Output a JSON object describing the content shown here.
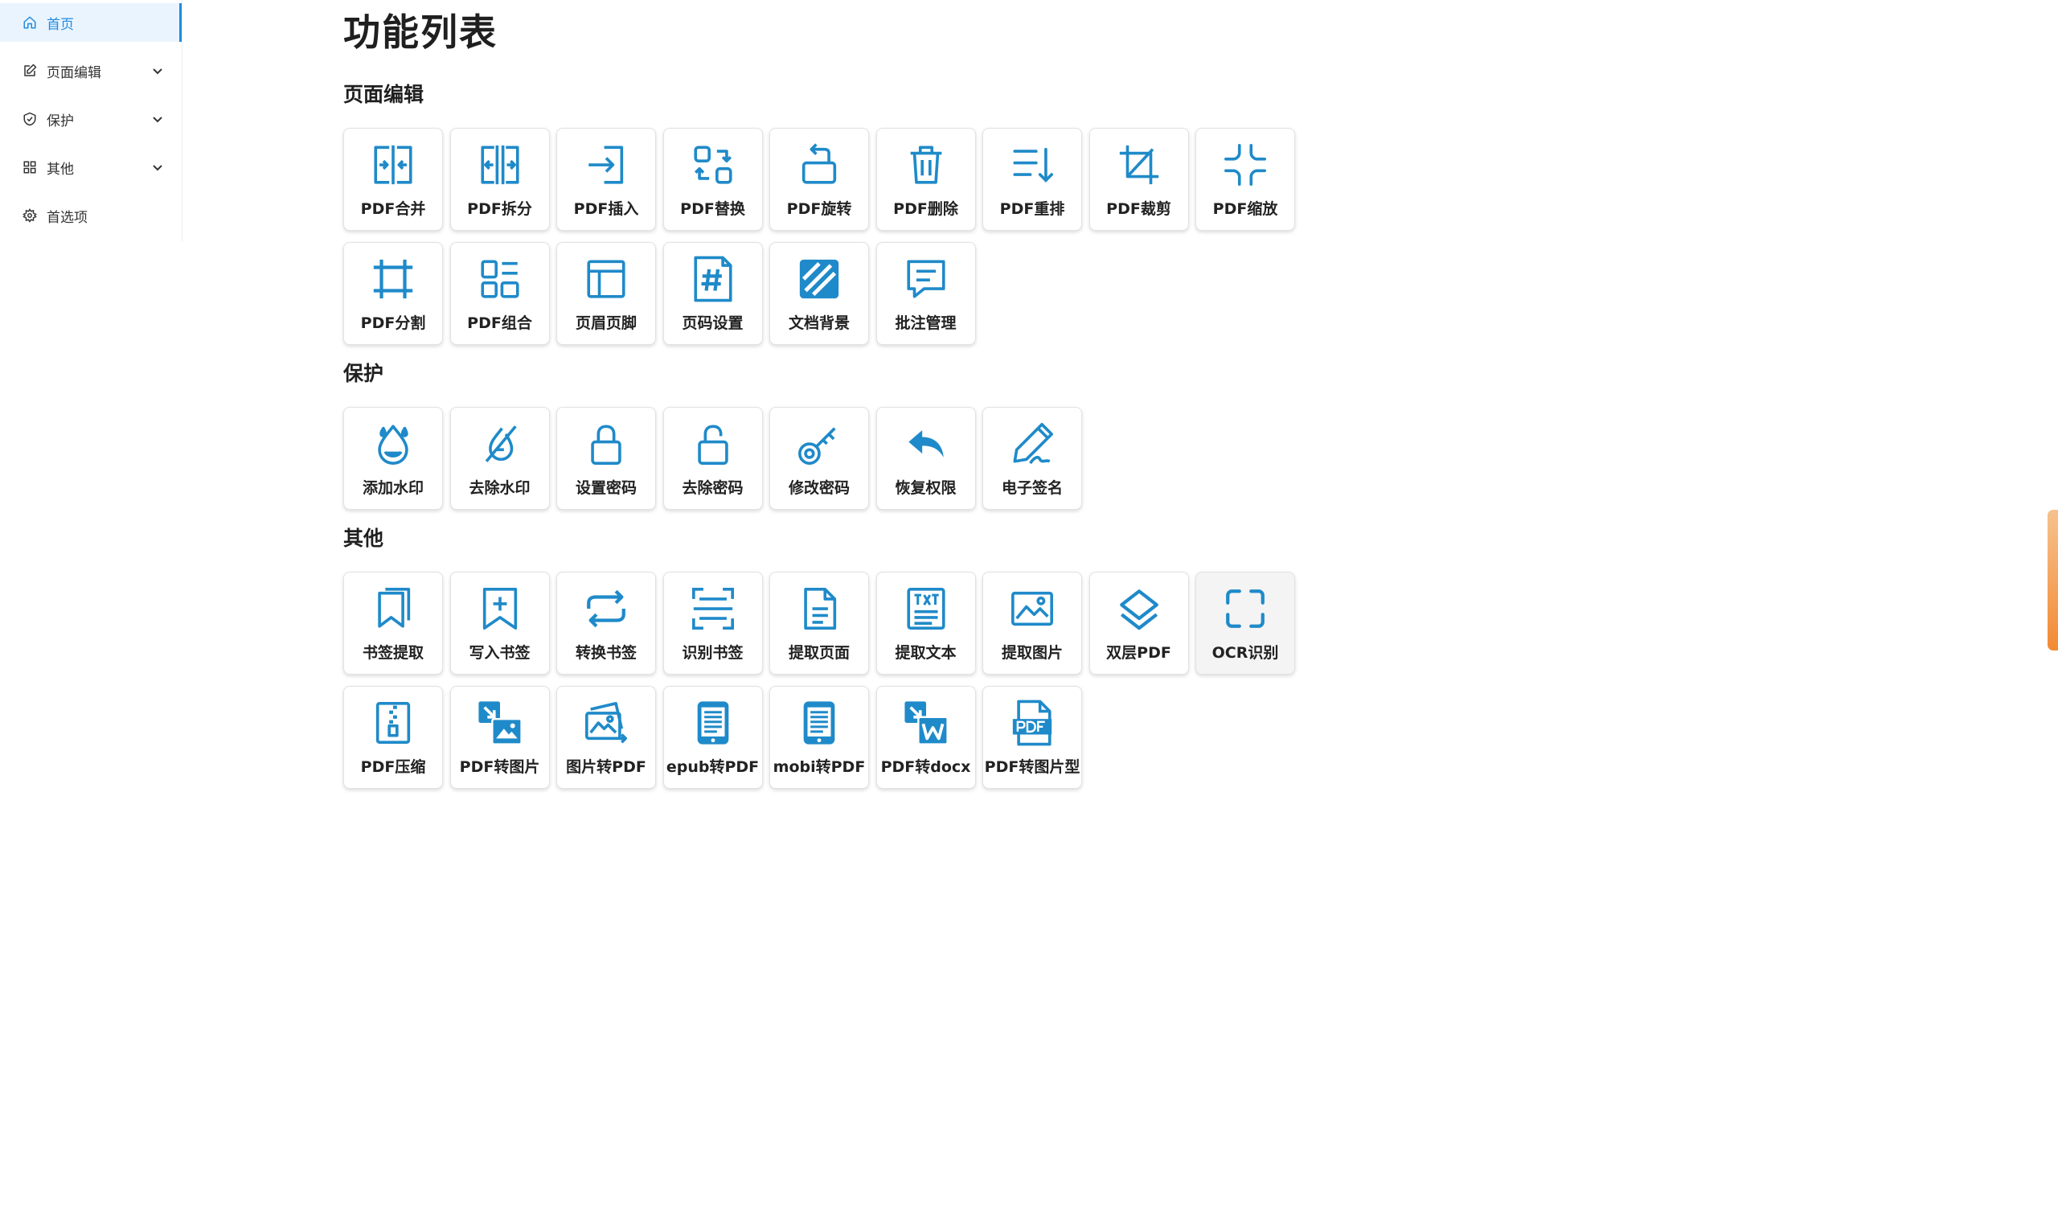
{
  "sidebar": {
    "items": [
      {
        "label": "首页",
        "icon": "home-icon"
      },
      {
        "label": "页面编辑",
        "icon": "edit-icon"
      },
      {
        "label": "保护",
        "icon": "shield-icon"
      },
      {
        "label": "其他",
        "icon": "apps-icon"
      },
      {
        "label": "首选项",
        "icon": "gear-icon"
      }
    ]
  },
  "main": {
    "title": "功能列表",
    "sections": [
      {
        "title": "页面编辑",
        "tiles": [
          {
            "label": "PDF合并",
            "icon": "merge-icon"
          },
          {
            "label": "PDF拆分",
            "icon": "split-icon"
          },
          {
            "label": "PDF插入",
            "icon": "insert-icon"
          },
          {
            "label": "PDF替换",
            "icon": "replace-icon"
          },
          {
            "label": "PDF旋转",
            "icon": "rotate-icon"
          },
          {
            "label": "PDF删除",
            "icon": "trash-icon"
          },
          {
            "label": "PDF重排",
            "icon": "reorder-icon"
          },
          {
            "label": "PDF裁剪",
            "icon": "crop-icon"
          },
          {
            "label": "PDF缩放",
            "icon": "shrink-icon"
          },
          {
            "label": "PDF分割",
            "icon": "cut-frame-icon"
          },
          {
            "label": "PDF组合",
            "icon": "layout-icon"
          },
          {
            "label": "页眉页脚",
            "icon": "header-footer-icon"
          },
          {
            "label": "页码设置",
            "icon": "page-number-icon"
          },
          {
            "label": "文档背景",
            "icon": "background-icon"
          },
          {
            "label": "批注管理",
            "icon": "comment-icon"
          }
        ]
      },
      {
        "title": "保护",
        "tiles": [
          {
            "label": "添加水印",
            "icon": "watermark-icon"
          },
          {
            "label": "去除水印",
            "icon": "remove-watermark-icon"
          },
          {
            "label": "设置密码",
            "icon": "lock-icon"
          },
          {
            "label": "去除密码",
            "icon": "unlock-icon"
          },
          {
            "label": "修改密码",
            "icon": "key-icon"
          },
          {
            "label": "恢复权限",
            "icon": "undo-icon"
          },
          {
            "label": "电子签名",
            "icon": "signature-icon"
          }
        ]
      },
      {
        "title": "其他",
        "tiles": [
          {
            "label": "书签提取",
            "icon": "bookmark-extract-icon"
          },
          {
            "label": "写入书签",
            "icon": "bookmark-add-icon"
          },
          {
            "label": "转换书签",
            "icon": "convert-icon"
          },
          {
            "label": "识别书签",
            "icon": "scan-lines-icon"
          },
          {
            "label": "提取页面",
            "icon": "document-icon"
          },
          {
            "label": "提取文本",
            "icon": "txt-icon"
          },
          {
            "label": "提取图片",
            "icon": "image-icon"
          },
          {
            "label": "双层PDF",
            "icon": "layers-icon"
          },
          {
            "label": "OCR识别",
            "icon": "ocr-scan-icon"
          },
          {
            "label": "PDF压缩",
            "icon": "zip-icon"
          },
          {
            "label": "PDF转图片",
            "icon": "pdf-to-image-icon"
          },
          {
            "label": "图片转PDF",
            "icon": "image-to-pdf-icon"
          },
          {
            "label": "epub转PDF",
            "icon": "epub-icon"
          },
          {
            "label": "mobi转PDF",
            "icon": "mobi-icon"
          },
          {
            "label": "PDF转docx",
            "icon": "pdf-to-word-icon"
          },
          {
            "label": "PDF转图片型",
            "icon": "pdf-file-icon"
          }
        ]
      }
    ]
  },
  "colors": {
    "accent": "#1f8be0",
    "icon": "#1f8ac9",
    "active_bg": "#eaf4ff",
    "scroll_thumb": "#f28a35"
  }
}
